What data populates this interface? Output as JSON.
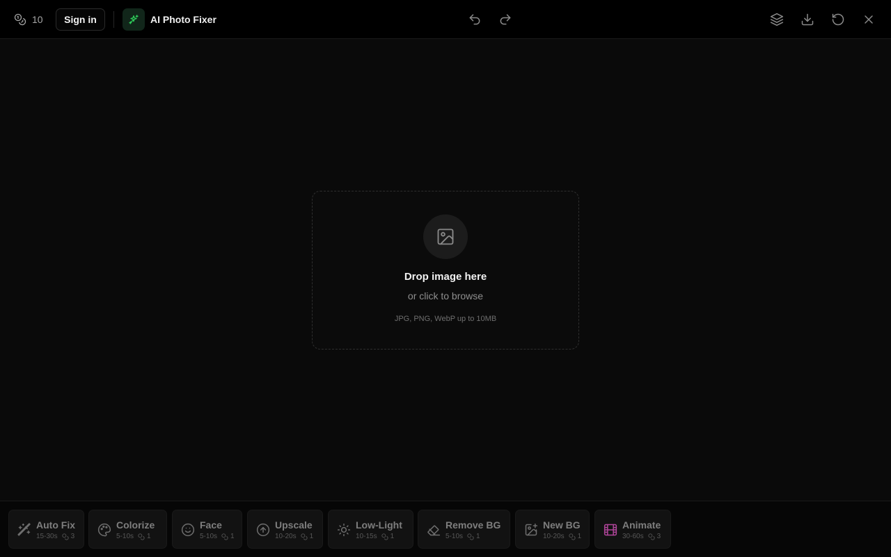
{
  "header": {
    "credits_value": "10",
    "credits_icon": "coins-icon",
    "signin_label": "Sign in",
    "app_title": "AI Photo Fixer",
    "brand_icon": "sparkles-icon",
    "brand_color": "#2ecc5a",
    "actions": [
      "undo-icon",
      "redo-icon",
      "layers-icon",
      "download-icon",
      "reset-icon",
      "close-icon"
    ]
  },
  "dropzone": {
    "icon": "image-icon",
    "title": "Drop image here",
    "subtitle": "or click to browse",
    "hint": "JPG, PNG, WebP up to 10MB"
  },
  "tools": [
    {
      "name": "Auto Fix",
      "time": "15-30s",
      "cost": "3",
      "icon": "magic-wand-icon"
    },
    {
      "name": "Colorize",
      "time": "5-10s",
      "cost": "1",
      "icon": "palette-icon"
    },
    {
      "name": "Face",
      "time": "5-10s",
      "cost": "1",
      "icon": "smile-icon"
    },
    {
      "name": "Upscale",
      "time": "10-20s",
      "cost": "1",
      "icon": "arrow-up-circle-icon"
    },
    {
      "name": "Low-Light",
      "time": "10-15s",
      "cost": "1",
      "icon": "sun-icon"
    },
    {
      "name": "Remove BG",
      "time": "5-10s",
      "cost": "1",
      "icon": "eraser-icon"
    },
    {
      "name": "New BG",
      "time": "10-20s",
      "cost": "1",
      "icon": "image-plus-icon"
    },
    {
      "name": "Animate",
      "time": "30-60s",
      "cost": "3",
      "icon": "film-icon",
      "accent": "#b0459a"
    }
  ]
}
